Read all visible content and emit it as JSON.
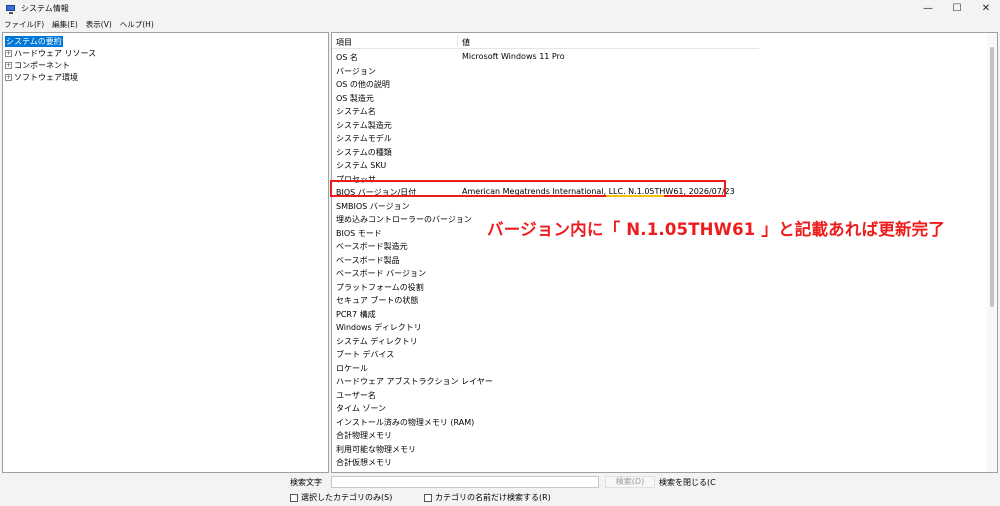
{
  "window": {
    "title": "システム情報",
    "controls": {
      "minimize": "—",
      "maximize": "☐",
      "close": "✕"
    }
  },
  "menu": [
    "ファイル(F)",
    "編集(E)",
    "表示(V)",
    "ヘルプ(H)"
  ],
  "tree": [
    {
      "label": "システムの要約",
      "selected": true,
      "expandable": false
    },
    {
      "label": "ハードウェア リソース",
      "selected": false,
      "expandable": true
    },
    {
      "label": "コンポーネント",
      "selected": false,
      "expandable": true
    },
    {
      "label": "ソフトウェア環境",
      "selected": false,
      "expandable": true
    }
  ],
  "table": {
    "headers": {
      "item": "項目",
      "value": "値"
    },
    "rows": [
      {
        "item": "OS 名",
        "value": "Microsoft Windows 11 Pro"
      },
      {
        "item": "バージョン",
        "value": ""
      },
      {
        "item": "OS の他の説明",
        "value": ""
      },
      {
        "item": "OS 製造元",
        "value": ""
      },
      {
        "item": "システム名",
        "value": ""
      },
      {
        "item": "システム製造元",
        "value": ""
      },
      {
        "item": "システムモデル",
        "value": ""
      },
      {
        "item": "システムの種類",
        "value": ""
      },
      {
        "item": "システム SKU",
        "value": ""
      },
      {
        "item": "プロセッサ",
        "value": ""
      },
      {
        "item": "BIOS バージョン/日付",
        "value": "American Megatrends International, LLC. N.1.05THW61, 2026/07/23"
      },
      {
        "item": "SMBIOS バージョン",
        "value": ""
      },
      {
        "item": "埋め込みコントローラーのバージョン",
        "value": ""
      },
      {
        "item": "BIOS モード",
        "value": ""
      },
      {
        "item": "ベースボード製造元",
        "value": ""
      },
      {
        "item": "ベースボード製品",
        "value": ""
      },
      {
        "item": "ベースボード バージョン",
        "value": ""
      },
      {
        "item": "プラットフォームの役割",
        "value": ""
      },
      {
        "item": "セキュア ブートの状態",
        "value": ""
      },
      {
        "item": "PCR7 構成",
        "value": ""
      },
      {
        "item": "Windows ディレクトリ",
        "value": ""
      },
      {
        "item": "システム ディレクトリ",
        "value": ""
      },
      {
        "item": "ブート デバイス",
        "value": ""
      },
      {
        "item": "ロケール",
        "value": ""
      },
      {
        "item": "ハードウェア アブストラクション レイヤー",
        "value": ""
      },
      {
        "item": "ユーザー名",
        "value": ""
      },
      {
        "item": "タイム ゾーン",
        "value": ""
      },
      {
        "item": "インストール済みの物理メモリ (RAM)",
        "value": ""
      },
      {
        "item": "合計物理メモリ",
        "value": ""
      },
      {
        "item": "利用可能な物理メモリ",
        "value": ""
      },
      {
        "item": "合計仮想メモリ",
        "value": ""
      },
      {
        "item": "利用可能な仮想メモリ",
        "value": ""
      }
    ]
  },
  "annotation": {
    "text": "バージョン内に「 N.1.05THW61 」と記載あれば更新完了",
    "color": "#ee1c1c",
    "underline_color": "#f2c200"
  },
  "footer": {
    "search_label": "検索文字",
    "search_value": "",
    "find_button": "検索(D)",
    "close_find": "検索を閉じる(C",
    "checkbox_selected_category": "選択したカテゴリのみ(S)",
    "checkbox_category_names": "カテゴリの名前だけ検索する(R)"
  },
  "colors": {
    "selection": "#0078d7",
    "highlight_border": "#ee1c1c"
  }
}
